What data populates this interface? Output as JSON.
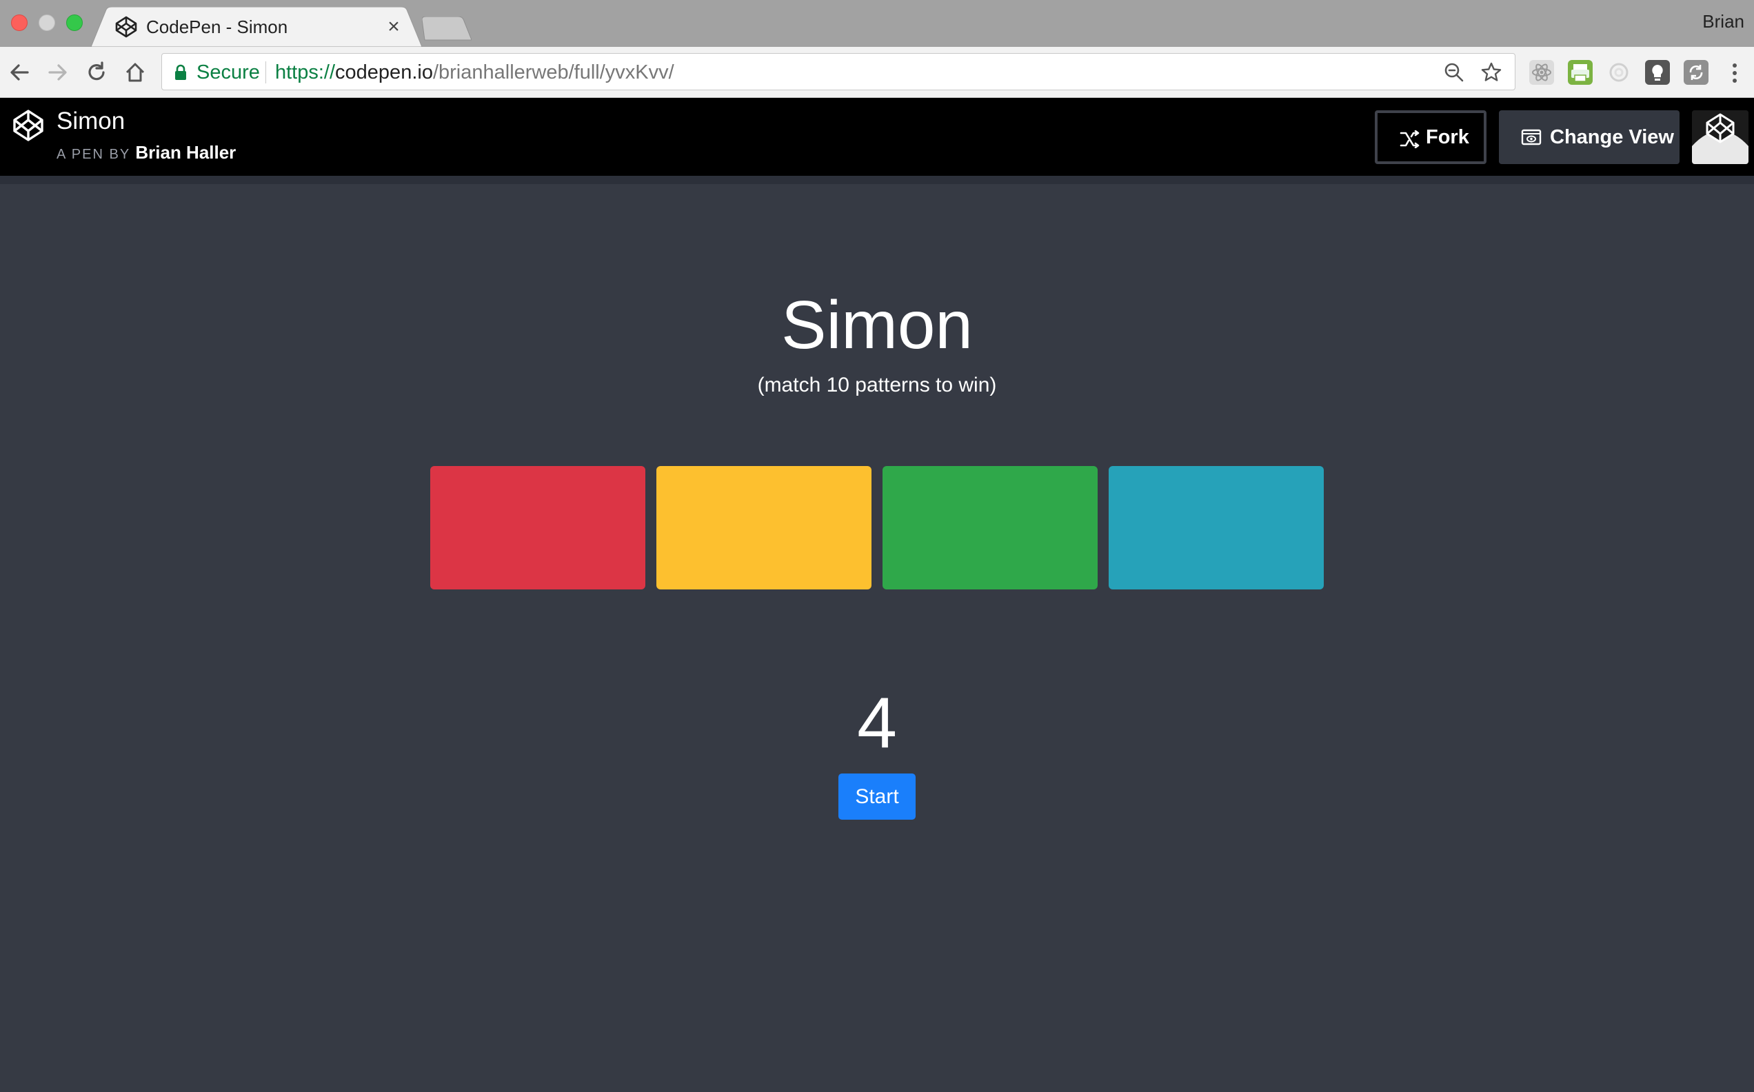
{
  "browser": {
    "tab_title": "CodePen - Simon",
    "tab_close_glyph": "×",
    "profile_name": "Brian",
    "security_label": "Secure",
    "url_scheme": "https://",
    "url_host": "codepen.io",
    "url_path": "/brianhallerweb/full/yvxKvv/"
  },
  "codepen_header": {
    "pen_title": "Simon",
    "byline_prefix": "A PEN BY",
    "author": "Brian Haller",
    "fork_label": "Fork",
    "change_view_label": "Change View"
  },
  "game": {
    "title": "Simon",
    "subtitle": "(match 10 patterns to win)",
    "pads": [
      {
        "name": "red",
        "color": "#dc3545"
      },
      {
        "name": "yellow",
        "color": "#fdc02f"
      },
      {
        "name": "green",
        "color": "#2fa84a"
      },
      {
        "name": "blue",
        "color": "#26a2b9"
      }
    ],
    "counter": "4",
    "start_label": "Start"
  },
  "colors": {
    "page_background": "#363a44",
    "header_background": "#000000",
    "start_button": "#1a7ffb"
  }
}
